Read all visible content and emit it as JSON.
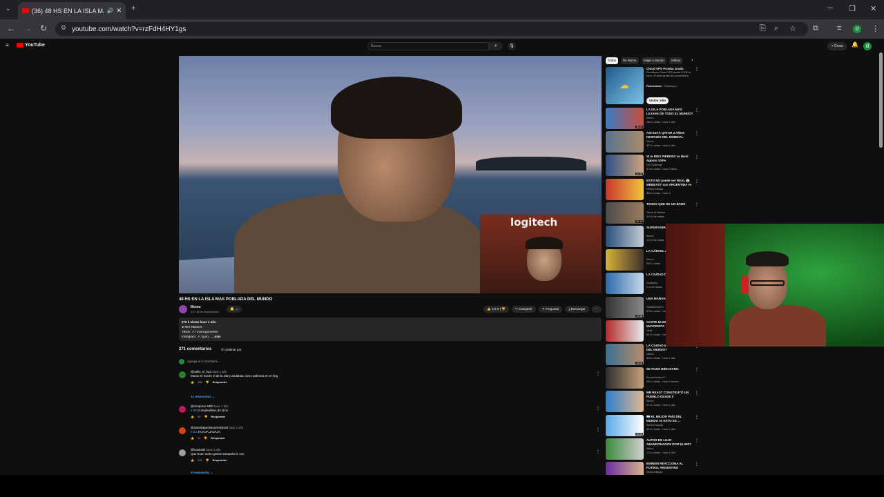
{
  "browser": {
    "tab_title": "(36) 48 HS EN LA ISLA MAS",
    "url": "youtube.com/watch?v=rzFdH4HY1gs",
    "profile_initial": "d"
  },
  "youtube": {
    "logo_text": "YouTube",
    "search_placeholder": "Buscar",
    "create_label": "Crear",
    "notif_count": "9+"
  },
  "video": {
    "overlay_brand": "logitech",
    "title": "48 HS EN LA ISLA MAS POBLADA DEL MUNDO",
    "channel": "Momo",
    "subscribers": "1,77 M de suscriptores",
    "likes": "8,9 K",
    "share_label": "Compartir",
    "ask_label": "Preguntar",
    "download_label": "Descargar",
    "description": {
      "line1": "276 k vistas  hace 1 año",
      "line2": "►MIS REDES:",
      "line3": "Tiktok: ↗ / momogomelmo",
      "line4": "Instagram: ↗ / gom...",
      "more": "...más"
    }
  },
  "comments": {
    "header": "271 comentarios",
    "sort_label": "Ordenar por",
    "add_placeholder": "Agrega un comentario...",
    "reply_label": "Responder",
    "items": [
      {
        "author": "@pablo_el_fuco",
        "time": "hace 1 año",
        "text": "Momo te hacés el de la isla y andabas como palmera en el ring",
        "likes": "458",
        "replies": "11 respuestas",
        "color": "#2e7d32"
      },
      {
        "author": "@elcopezer-s4fth",
        "time": "hace 1 año",
        "timestamp": "4:38",
        "text": "Cumpleañitos de Dios",
        "likes": "40",
        "replies": "",
        "color": "#c2185b"
      },
      {
        "author": "@daniolakjandrasacheb4832",
        "time": "hace 1 año",
        "timestamp": "6:32",
        "text": "JAJAJA,JAJAJA",
        "likes": "11",
        "replies": "",
        "color": "#d84315"
      },
      {
        "author": "@loou8492",
        "time": "hace 1 año",
        "text": "Que buen video genio! Después lo veo",
        "likes": "203",
        "replies": "3 respuestas",
        "color": "#9e9e9e"
      }
    ]
  },
  "sidebar": {
    "chips": [
      "Todos",
      "De Momo",
      "Viajar a Mundo",
      "Videos"
    ],
    "ad": {
      "title": "Cloud VPS Prueba Gratis",
      "desc": "Servidores Cloud VPS desde 0,30€ la hora. ¡Prueba gratis sin compromiso.",
      "label": "Patrocinado",
      "advertiser": "Clouding.io",
      "visit": "Visitar sitio"
    },
    "items": [
      {
        "title": "LA ISLA POBLADA MAS LEJANA DE TODO EL MUNDO?",
        "channel": "Momo",
        "views": "486 k vistas · hace 1 año",
        "duration": "18:21",
        "c1": "#3b7bc8",
        "c2": "#c94d3a"
      },
      {
        "title": "ASÍ ESTÁ QATAR 2 AÑOS DESPUÉS DEL MUNDIAL",
        "channel": "Momo",
        "views": "452 k vistas · hace 1 año",
        "duration": "",
        "c1": "#5a7390",
        "c2": "#a98a6b"
      },
      {
        "title": "SI te RIES PIERDES vs Nivel Agosto 100%",
        "channel": "Gil Challenge",
        "views": "675 k vistas · hace 2 años",
        "duration": "22:32",
        "c1": "#2c4f86",
        "c2": "#cfa37c"
      },
      {
        "title": "ESTO NO puede ser REAL 😱 MRBEAST con ARGENTINA vs",
        "channel": "Elefteo Naraja",
        "views": "865 k vistas · hace 3",
        "duration": "",
        "c1": "#c7372f",
        "c2": "#f3c43b"
      },
      {
        "title": "TENGO QUE DE UN BARR",
        "channel": "Yerba el Italiano",
        "views": "2,9 M de vistas",
        "duration": "26:14",
        "c1": "#4a4a4a",
        "c2": "#9b7b5d"
      },
      {
        "title": "SUPERVIVEN MÁS FRÍO DE",
        "channel": "Momo",
        "views": "1,5 M de vistas",
        "duration": "",
        "c1": "#2a4f7a",
        "c2": "#c4cbd6"
      },
      {
        "title": "LA CÁRCEL ARGENTINA",
        "channel": "Momo",
        "views": "560 k vistas",
        "duration": "",
        "c1": "#d7b23a",
        "c2": "#3f2f2a"
      },
      {
        "title": "LA CIUDAD DEL MUNDO",
        "channel": "Goldenky",
        "views": "2 M de vistas",
        "duration": "",
        "c1": "#2d6aa8",
        "c2": "#c5d9ea"
      },
      {
        "title": "UNA MAÑAN MOTO con la",
        "channel": "OrtaBetGnet1+",
        "views": "575 k vistas · hace 4 semanas",
        "duration": "17:38",
        "c1": "#333",
        "c2": "#888"
      },
      {
        "title": "GASTE $2.000.000 EN UN MAYORISTA",
        "channel": "Vitae",
        "views": "601 k vistas · hace 2 días",
        "duration": "",
        "c1": "#b32a2a",
        "c2": "#e9e9e9"
      },
      {
        "title": "LA CIUDAD MÁS PELIGROSA DEL MUNDO?",
        "channel": "Momo",
        "views": "308 k vistas · hace 1 año",
        "duration": "12:05",
        "c1": "#3b6f92",
        "c2": "#b68b6b"
      },
      {
        "title": "SE PUSO BIEN RARO",
        "channel": "BrunoFerreira77",
        "views": "262 k vistas · hace 5 meses",
        "duration": "",
        "c1": "#2e2e2e",
        "c2": "#c6a07a"
      },
      {
        "title": "MR BEAST CONSTRUYÓ UN PUEBLO DESDE 0",
        "channel": "Momo",
        "views": "271 k vistas · hace 1 año",
        "duration": "",
        "c1": "#2a7fd0",
        "c2": "#e2b88d"
      },
      {
        "title": "🇦🇷 EL MEJOR PAÍS DEL MUNDO es ESTO ES ...",
        "channel": "Elefteo Naraja",
        "views": "401 k vistas · hace 1 año",
        "duration": "12:04",
        "c1": "#5aa9e6",
        "c2": "#ffffff"
      },
      {
        "title": "AUTOS DE LUJO ABANDONADOS POR $1.000?",
        "channel": "Momo",
        "views": "171 k vistas · hace 1 año",
        "duration": "",
        "c1": "#3b8a3a",
        "c2": "#d0d0d0"
      },
      {
        "title": "EMINEM REACCIONA AL FUTBOL ARGENTINO",
        "channel": "Grimeediting1",
        "views": "",
        "duration": "",
        "c1": "#6a2fa0",
        "c2": "#d8b08e"
      }
    ]
  }
}
